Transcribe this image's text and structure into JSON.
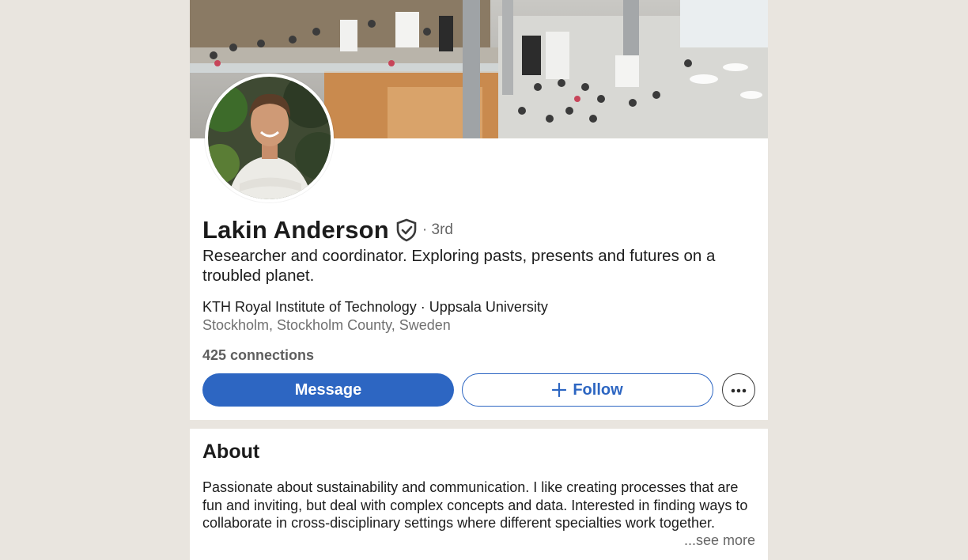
{
  "profile": {
    "name": "Lakin Anderson",
    "degree": "· 3rd",
    "headline": "Researcher and coordinator. Exploring pasts, presents and futures on a troubled planet.",
    "organizations": "KTH Royal Institute of Technology · Uppsala University",
    "location": "Stockholm, Stockholm County, Sweden",
    "connections": "425 connections"
  },
  "actions": {
    "message_label": "Message",
    "follow_label": "Follow"
  },
  "about": {
    "title": "About",
    "text": "Passionate about sustainability and communication. I like creating processes that are fun and inviting, but deal with complex concepts and data. Interested in finding ways to collaborate in cross-disciplinary settings where different specialties work together.",
    "see_more": "...see more"
  },
  "colors": {
    "primary": "#2d66c2",
    "background": "#e9e5df",
    "card": "#ffffff"
  },
  "icons": [
    "verified-shield-icon",
    "plus-icon",
    "more-options-icon"
  ]
}
